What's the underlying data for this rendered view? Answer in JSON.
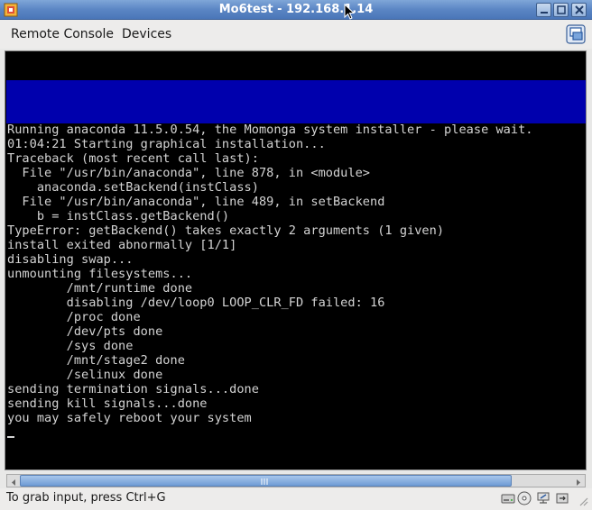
{
  "window": {
    "title": "Mo6test - 192.168.1.14",
    "icon": "vmware-icon"
  },
  "menu": {
    "remote_console": "Remote Console",
    "devices": "Devices"
  },
  "console": {
    "lines": [
      "Running anaconda 11.5.0.54, the Momonga system installer - please wait.",
      "01:04:21 Starting graphical installation...",
      "Traceback (most recent call last):",
      "  File \"/usr/bin/anaconda\", line 878, in <module>",
      "    anaconda.setBackend(instClass)",
      "  File \"/usr/bin/anaconda\", line 489, in setBackend",
      "    b = instClass.getBackend()",
      "TypeError: getBackend() takes exactly 2 arguments (1 given)",
      "install exited abnormally [1/1]",
      "disabling swap...",
      "unmounting filesystems...",
      "        /mnt/runtime done",
      "        disabling /dev/loop0 LOOP_CLR_FD failed: 16",
      "        /proc done",
      "        /dev/pts done",
      "        /sys done",
      "        /mnt/stage2 done",
      "        /selinux done",
      "sending termination signals...done",
      "sending kill signals...done",
      "you may safely reboot your system"
    ],
    "colors": {
      "background": "#000000",
      "band": "#0000ad",
      "text": "#d4d4d4"
    }
  },
  "statusbar": {
    "text": "To grab input, press Ctrl+G",
    "icons": [
      "hard-disk-icon",
      "cdrom-icon",
      "network-icon",
      "usb-icon"
    ]
  },
  "theme": {
    "titlebar": "#5b86c4",
    "accent": "#6e9bd4"
  }
}
